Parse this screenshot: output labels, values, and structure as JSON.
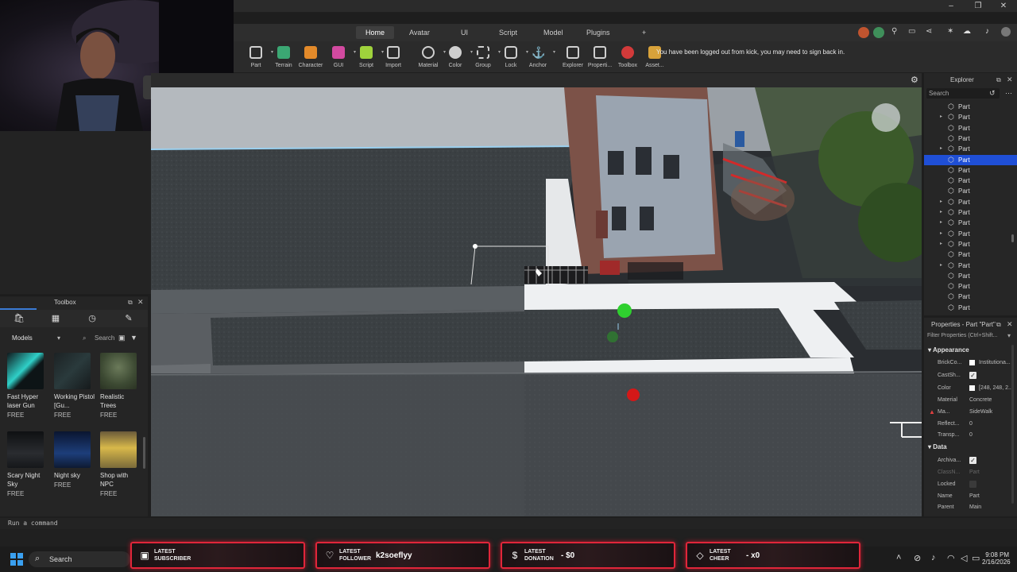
{
  "tabs": [
    "Home",
    "Avatar",
    "UI",
    "Script",
    "Model",
    "Plugins",
    "+"
  ],
  "active_tab": "Home",
  "toolbar": {
    "tools": [
      "Part",
      "Terrain",
      "Character",
      "GUI",
      "Script",
      "Import",
      "Material",
      "Color",
      "Group",
      "Lock",
      "Anchor",
      "Explorer",
      "Properti...",
      "Toolbox",
      "Asset..."
    ],
    "notice": "You have been logged out from kick, you may need to sign back in."
  },
  "toolbox": {
    "title": "Toolbox",
    "category": "Models",
    "search_placeholder": "Search",
    "items": [
      {
        "name": "Fast Hyper laser Gun",
        "price": "FREE"
      },
      {
        "name": "Working Pistol [Gu...",
        "price": "FREE"
      },
      {
        "name": "Realistic Trees",
        "price": "FREE"
      },
      {
        "name": "Scary Night Sky",
        "price": "FREE"
      },
      {
        "name": "Night sky",
        "price": "FREE"
      },
      {
        "name": "Shop with NPC",
        "price": "FREE"
      }
    ]
  },
  "explorer": {
    "title": "Explorer",
    "search_placeholder": "Search",
    "items": [
      "Part",
      "Part",
      "Part",
      "Part",
      "Part",
      "Part",
      "Part",
      "Part",
      "Part",
      "Part",
      "Part",
      "Part",
      "Part",
      "Part",
      "Part",
      "Part",
      "Part",
      "Part",
      "Part",
      "Part"
    ]
  },
  "properties": {
    "title": "Properties - Part \"Part\"",
    "filter_placeholder": "Filter Properties (Ctrl+Shift...",
    "sections": {
      "appearance": "Appearance",
      "data": "Data"
    },
    "rows": [
      {
        "label": "BrickCo...",
        "value": "Institutiona..."
      },
      {
        "label": "CastSh...",
        "value": ""
      },
      {
        "label": "Color",
        "value": "[248, 248, 2..."
      },
      {
        "label": "Material",
        "value": "Concrete"
      },
      {
        "label": "Ma...",
        "value": "SideWalk"
      },
      {
        "label": "Reflect...",
        "value": "0"
      },
      {
        "label": "Transp...",
        "value": "0"
      },
      {
        "label": "Archiva...",
        "value": ""
      },
      {
        "label": "ClassN...",
        "value": "Part"
      },
      {
        "label": "Locked",
        "value": ""
      },
      {
        "label": "Name",
        "value": "Part"
      },
      {
        "label": "Parent",
        "value": "Main"
      }
    ]
  },
  "command_bar": {
    "placeholder": "Run a command"
  },
  "stream_alerts": [
    {
      "line1": "LATEST",
      "line2": "SUBSCRIBER",
      "value": ""
    },
    {
      "line1": "LATEST",
      "line2": "FOLLOWER",
      "value": "k2soeflyy"
    },
    {
      "line1": "LATEST",
      "line2": "DONATION",
      "value": "- $0"
    },
    {
      "line1": "LATEST",
      "line2": "CHEER",
      "value": "- x0"
    }
  ],
  "taskbar": {
    "search": "Search",
    "time": "9:08 PM",
    "date": "2/16/2026"
  },
  "colors": {
    "selection": "#1f4fd6",
    "alert_border": "#e0263a"
  }
}
